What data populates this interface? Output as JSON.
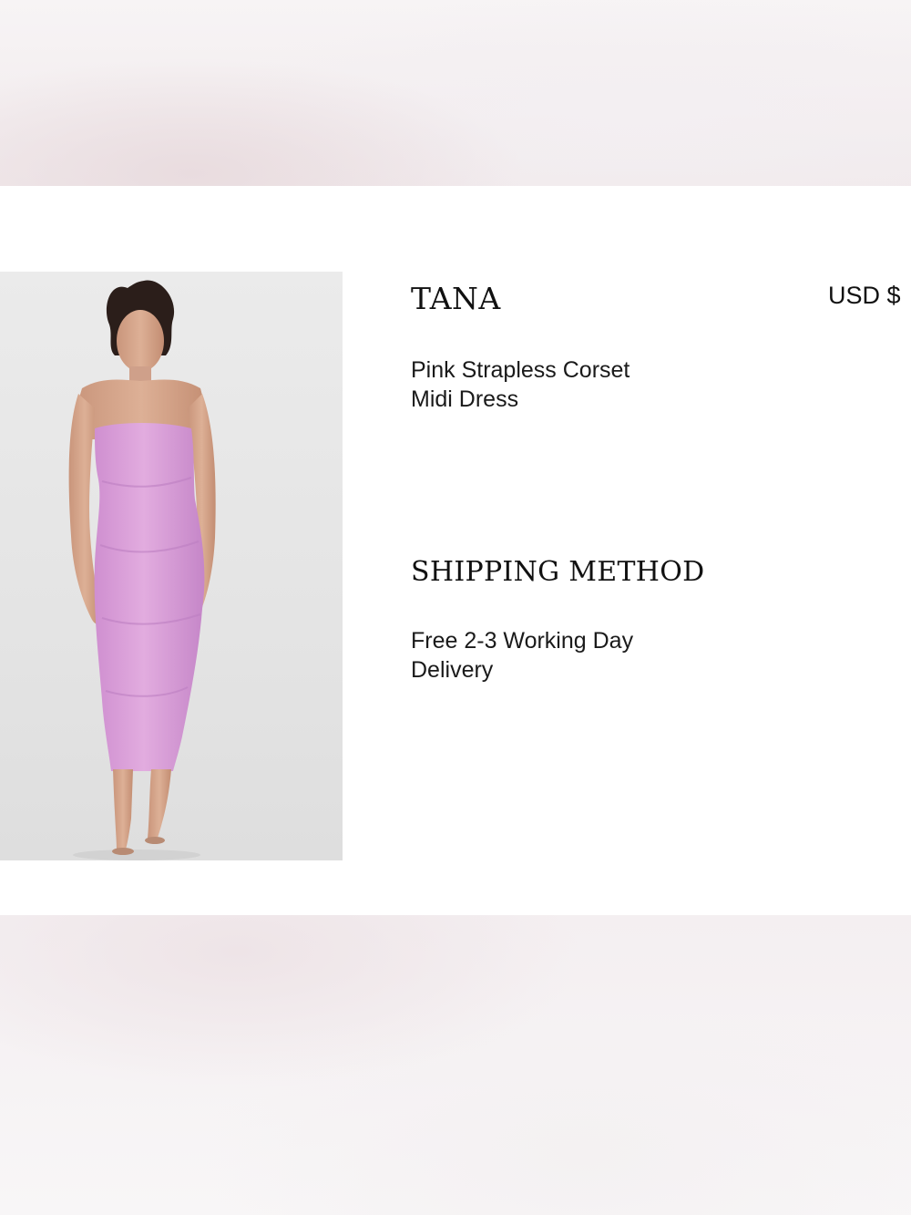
{
  "product": {
    "brand": "TANA",
    "price": "USD $",
    "name_line1": "Pink Strapless Corset",
    "name_line2": "Midi Dress",
    "image_icon": "product-photo"
  },
  "shipping": {
    "title": "SHIPPING METHOD",
    "line1": "Free 2-3 Working Day",
    "line2": "Delivery"
  },
  "colors": {
    "dress": "#d99fd9",
    "background": "#ffffff",
    "text": "#111111"
  }
}
